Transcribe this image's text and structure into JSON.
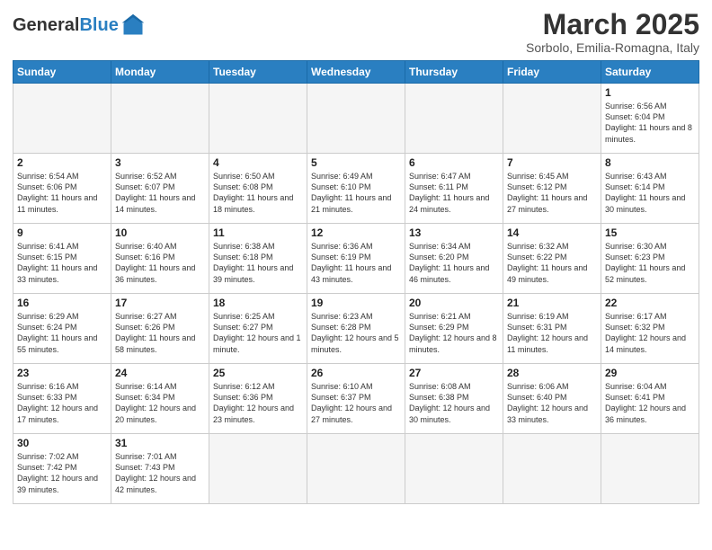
{
  "header": {
    "logo_general": "General",
    "logo_blue": "Blue",
    "month_title": "March 2025",
    "location": "Sorbolo, Emilia-Romagna, Italy"
  },
  "weekdays": [
    "Sunday",
    "Monday",
    "Tuesday",
    "Wednesday",
    "Thursday",
    "Friday",
    "Saturday"
  ],
  "weeks": [
    [
      {
        "day": "",
        "empty": true
      },
      {
        "day": "",
        "empty": true
      },
      {
        "day": "",
        "empty": true
      },
      {
        "day": "",
        "empty": true
      },
      {
        "day": "",
        "empty": true
      },
      {
        "day": "",
        "empty": true
      },
      {
        "day": "1",
        "sunrise": "6:56 AM",
        "sunset": "6:04 PM",
        "daylight": "11 hours and 8 minutes."
      }
    ],
    [
      {
        "day": "2",
        "sunrise": "6:54 AM",
        "sunset": "6:06 PM",
        "daylight": "11 hours and 11 minutes."
      },
      {
        "day": "3",
        "sunrise": "6:52 AM",
        "sunset": "6:07 PM",
        "daylight": "11 hours and 14 minutes."
      },
      {
        "day": "4",
        "sunrise": "6:50 AM",
        "sunset": "6:08 PM",
        "daylight": "11 hours and 18 minutes."
      },
      {
        "day": "5",
        "sunrise": "6:49 AM",
        "sunset": "6:10 PM",
        "daylight": "11 hours and 21 minutes."
      },
      {
        "day": "6",
        "sunrise": "6:47 AM",
        "sunset": "6:11 PM",
        "daylight": "11 hours and 24 minutes."
      },
      {
        "day": "7",
        "sunrise": "6:45 AM",
        "sunset": "6:12 PM",
        "daylight": "11 hours and 27 minutes."
      },
      {
        "day": "8",
        "sunrise": "6:43 AM",
        "sunset": "6:14 PM",
        "daylight": "11 hours and 30 minutes."
      }
    ],
    [
      {
        "day": "9",
        "sunrise": "6:41 AM",
        "sunset": "6:15 PM",
        "daylight": "11 hours and 33 minutes."
      },
      {
        "day": "10",
        "sunrise": "6:40 AM",
        "sunset": "6:16 PM",
        "daylight": "11 hours and 36 minutes."
      },
      {
        "day": "11",
        "sunrise": "6:38 AM",
        "sunset": "6:18 PM",
        "daylight": "11 hours and 39 minutes."
      },
      {
        "day": "12",
        "sunrise": "6:36 AM",
        "sunset": "6:19 PM",
        "daylight": "11 hours and 43 minutes."
      },
      {
        "day": "13",
        "sunrise": "6:34 AM",
        "sunset": "6:20 PM",
        "daylight": "11 hours and 46 minutes."
      },
      {
        "day": "14",
        "sunrise": "6:32 AM",
        "sunset": "6:22 PM",
        "daylight": "11 hours and 49 minutes."
      },
      {
        "day": "15",
        "sunrise": "6:30 AM",
        "sunset": "6:23 PM",
        "daylight": "11 hours and 52 minutes."
      }
    ],
    [
      {
        "day": "16",
        "sunrise": "6:29 AM",
        "sunset": "6:24 PM",
        "daylight": "11 hours and 55 minutes."
      },
      {
        "day": "17",
        "sunrise": "6:27 AM",
        "sunset": "6:26 PM",
        "daylight": "11 hours and 58 minutes."
      },
      {
        "day": "18",
        "sunrise": "6:25 AM",
        "sunset": "6:27 PM",
        "daylight": "12 hours and 1 minute."
      },
      {
        "day": "19",
        "sunrise": "6:23 AM",
        "sunset": "6:28 PM",
        "daylight": "12 hours and 5 minutes."
      },
      {
        "day": "20",
        "sunrise": "6:21 AM",
        "sunset": "6:29 PM",
        "daylight": "12 hours and 8 minutes."
      },
      {
        "day": "21",
        "sunrise": "6:19 AM",
        "sunset": "6:31 PM",
        "daylight": "12 hours and 11 minutes."
      },
      {
        "day": "22",
        "sunrise": "6:17 AM",
        "sunset": "6:32 PM",
        "daylight": "12 hours and 14 minutes."
      }
    ],
    [
      {
        "day": "23",
        "sunrise": "6:16 AM",
        "sunset": "6:33 PM",
        "daylight": "12 hours and 17 minutes."
      },
      {
        "day": "24",
        "sunrise": "6:14 AM",
        "sunset": "6:34 PM",
        "daylight": "12 hours and 20 minutes."
      },
      {
        "day": "25",
        "sunrise": "6:12 AM",
        "sunset": "6:36 PM",
        "daylight": "12 hours and 23 minutes."
      },
      {
        "day": "26",
        "sunrise": "6:10 AM",
        "sunset": "6:37 PM",
        "daylight": "12 hours and 27 minutes."
      },
      {
        "day": "27",
        "sunrise": "6:08 AM",
        "sunset": "6:38 PM",
        "daylight": "12 hours and 30 minutes."
      },
      {
        "day": "28",
        "sunrise": "6:06 AM",
        "sunset": "6:40 PM",
        "daylight": "12 hours and 33 minutes."
      },
      {
        "day": "29",
        "sunrise": "6:04 AM",
        "sunset": "6:41 PM",
        "daylight": "12 hours and 36 minutes."
      }
    ],
    [
      {
        "day": "30",
        "sunrise": "7:02 AM",
        "sunset": "7:42 PM",
        "daylight": "12 hours and 39 minutes."
      },
      {
        "day": "31",
        "sunrise": "7:01 AM",
        "sunset": "7:43 PM",
        "daylight": "12 hours and 42 minutes."
      },
      {
        "day": "",
        "empty": true
      },
      {
        "day": "",
        "empty": true
      },
      {
        "day": "",
        "empty": true
      },
      {
        "day": "",
        "empty": true
      },
      {
        "day": "",
        "empty": true
      }
    ]
  ]
}
